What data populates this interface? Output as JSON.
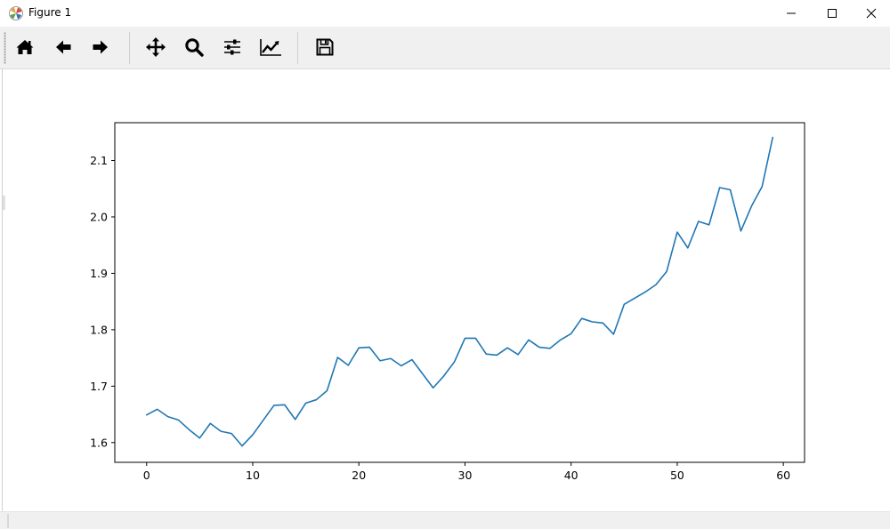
{
  "window": {
    "title": "Figure 1",
    "icon": "matplotlib-icon",
    "controls": [
      "minimize-icon",
      "maximize-icon",
      "close-icon"
    ]
  },
  "toolbar": {
    "tools": [
      {
        "name": "home",
        "icon": "home-icon"
      },
      {
        "name": "back",
        "icon": "arrow-left-icon"
      },
      {
        "name": "forward",
        "icon": "arrow-right-icon"
      },
      {
        "name": "pan",
        "icon": "move-icon"
      },
      {
        "name": "zoom",
        "icon": "magnifier-icon"
      },
      {
        "name": "subplots",
        "icon": "sliders-icon"
      },
      {
        "name": "customize",
        "icon": "line-chart-icon"
      },
      {
        "name": "save",
        "icon": "floppy-disk-icon"
      }
    ]
  },
  "status": {
    "text": ""
  },
  "colors": {
    "line": "#1f77b4",
    "toolbar": "#f0f0f0"
  },
  "chart_data": {
    "type": "line",
    "title": "",
    "xlabel": "",
    "ylabel": "",
    "xlim": [
      -3,
      62
    ],
    "ylim": [
      1.565,
      2.167
    ],
    "xticks": [
      0,
      10,
      20,
      30,
      40,
      50,
      60
    ],
    "xtick_labels": [
      "0",
      "10",
      "20",
      "30",
      "40",
      "50",
      "60"
    ],
    "yticks": [
      1.6,
      1.7,
      1.8,
      1.9,
      2.0,
      2.1
    ],
    "ytick_labels": [
      "1.6",
      "1.7",
      "1.8",
      "1.9",
      "2.0",
      "2.1"
    ],
    "grid": false,
    "legend": "none",
    "x": [
      0,
      1,
      2,
      3,
      4,
      5,
      6,
      7,
      8,
      9,
      10,
      11,
      12,
      13,
      14,
      15,
      16,
      17,
      18,
      19,
      20,
      21,
      22,
      23,
      24,
      25,
      26,
      27,
      28,
      29,
      30,
      31,
      32,
      33,
      34,
      35,
      36,
      37,
      38,
      39,
      40,
      41,
      42,
      43,
      44,
      45,
      46,
      47,
      48,
      49,
      50,
      51,
      52,
      53,
      54,
      55,
      56,
      57,
      58,
      59
    ],
    "series": [
      {
        "values": [
          1.649,
          1.659,
          1.646,
          1.64,
          1.623,
          1.608,
          1.634,
          1.62,
          1.616,
          1.594,
          1.614,
          1.64,
          1.666,
          1.667,
          1.641,
          1.67,
          1.676,
          1.692,
          1.751,
          1.737,
          1.768,
          1.769,
          1.745,
          1.749,
          1.736,
          1.747,
          1.722,
          1.697,
          1.718,
          1.743,
          1.785,
          1.785,
          1.757,
          1.755,
          1.768,
          1.756,
          1.782,
          1.769,
          1.767,
          1.782,
          1.793,
          1.82,
          1.814,
          1.812,
          1.792,
          1.845,
          1.856,
          1.867,
          1.88,
          1.903,
          1.973,
          1.945,
          1.992,
          1.986,
          2.052,
          2.048,
          1.975,
          2.019,
          2.054,
          2.141
        ]
      }
    ]
  }
}
